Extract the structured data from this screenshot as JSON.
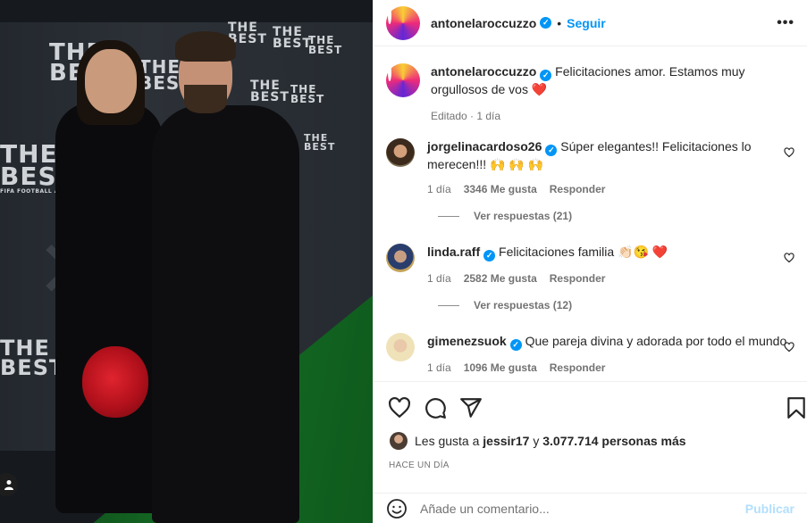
{
  "post": {
    "author": "antonelaroccuzzo",
    "follow_label": "Seguir",
    "separator": "•",
    "more_label": "•••",
    "verified_mark": "✓",
    "caption": {
      "username": "antonelaroccuzzo",
      "text": "Felicitaciones amor. Estamos muy orgullosos de vos",
      "emoji": "❤️",
      "meta": "Editado · 1 día"
    },
    "photo_text": {
      "logo_line1": "THE",
      "logo_line2": "BEST",
      "logo_sub": "FIFA FOOTBALL AWARDS",
      "corner_icon": "person-icon"
    }
  },
  "comments": [
    {
      "username": "jorgelinacardoso26",
      "text": "Súper elegantes!! Felicitaciones lo merecen!!! 🙌 🙌 🙌",
      "time": "1 día",
      "likes": "3346 Me gusta",
      "reply": "Responder",
      "view_replies": "Ver respuestas (21)"
    },
    {
      "username": "linda.raff",
      "text": "Felicitaciones familia 👏🏻😘 ❤️",
      "time": "1 día",
      "likes": "2582 Me gusta",
      "reply": "Responder",
      "view_replies": "Ver respuestas (12)"
    },
    {
      "username": "gimenezsuok",
      "text": "Que pareja divina y adorada por todo el mundo",
      "time": "1 día",
      "likes": "1096 Me gusta",
      "reply": "Responder"
    }
  ],
  "likes_line": {
    "prefix": "Les gusta a",
    "user": "jessir17",
    "middle": "y",
    "count": "3.077.714 personas más"
  },
  "timestamp": "HACE UN DÍA",
  "composer": {
    "placeholder": "Añade un comentario...",
    "publish_label": "Publicar"
  },
  "colors": {
    "accent": "#0095f6",
    "publish_disabled": "#b2dffc",
    "heart": "#ed1c24"
  },
  "icons": [
    "heart-icon",
    "comment-icon",
    "share-icon",
    "bookmark-icon",
    "emoji-icon",
    "more-icon",
    "verified-icon"
  ]
}
